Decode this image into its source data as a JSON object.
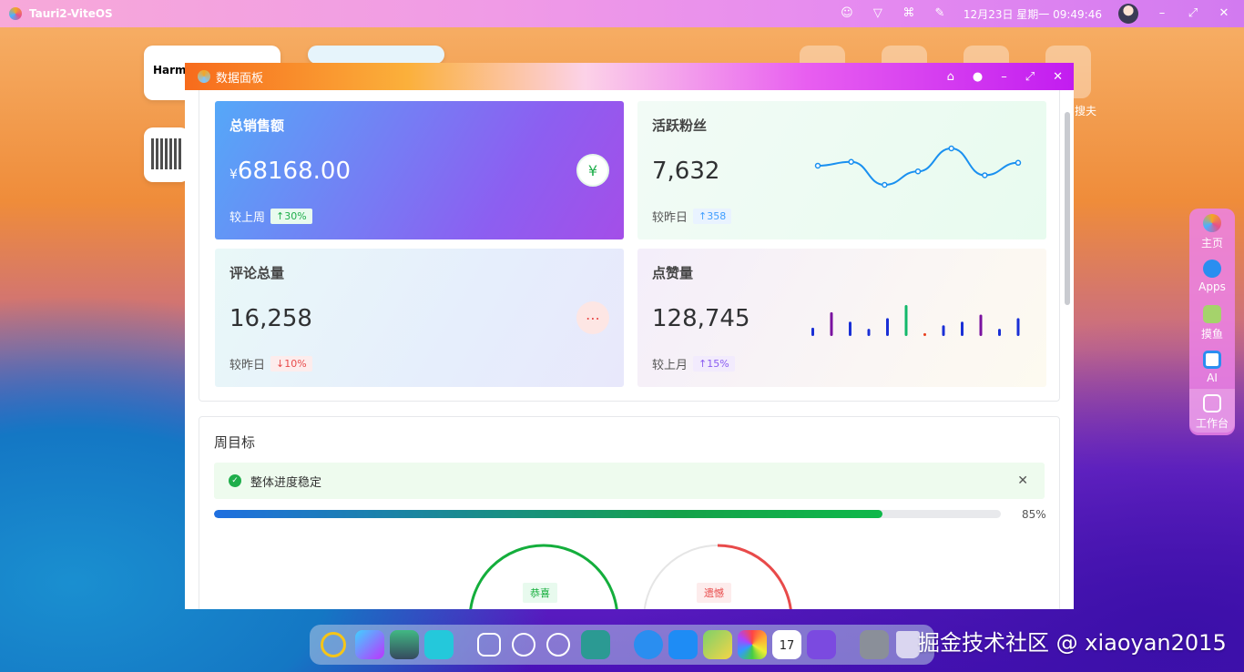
{
  "topbar": {
    "app_title": "Tauri2-ViteOS",
    "datetime": "12月23日 星期一 09:49:46"
  },
  "desktop": {
    "card_label": "Harmo",
    "group_label": "搜夫"
  },
  "window": {
    "title": "数据面板"
  },
  "cards": {
    "sales": {
      "title": "总销售额",
      "currency": "¥",
      "value": "68168.00",
      "compare_label": "较上周",
      "change": "↑30%"
    },
    "fans": {
      "title": "活跃粉丝",
      "value": "7,632",
      "compare_label": "较昨日",
      "change": "↑358"
    },
    "comments": {
      "title": "评论总量",
      "value": "16,258",
      "compare_label": "较昨日",
      "change": "↓10%"
    },
    "likes": {
      "title": "点赞量",
      "value": "128,745",
      "compare_label": "较上月",
      "change": "↑15%"
    }
  },
  "fans_sparkline": [
    4.2,
    4.6,
    2.2,
    3.6,
    6.0,
    3.2,
    4.5
  ],
  "likes_bars": [
    {
      "v": 0.35,
      "color": "#1a2fd6"
    },
    {
      "v": 1.0,
      "color": "#7a12a0"
    },
    {
      "v": 0.6,
      "color": "#1a2fd6"
    },
    {
      "v": 0.3,
      "color": "#1a2fd6"
    },
    {
      "v": 0.75,
      "color": "#1a2fd6"
    },
    {
      "v": 1.3,
      "color": "#12b86a"
    },
    {
      "v": 0.12,
      "color": "#e8411f"
    },
    {
      "v": 0.45,
      "color": "#1a2fd6"
    },
    {
      "v": 0.6,
      "color": "#1a2fd6"
    },
    {
      "v": 0.9,
      "color": "#7a12a0"
    },
    {
      "v": 0.3,
      "color": "#1a2fd6"
    },
    {
      "v": 0.75,
      "color": "#1a2fd6"
    }
  ],
  "goals": {
    "title": "周目标",
    "alert_text": "整体进度稳定",
    "progress": 0.85,
    "progress_text": "85%",
    "gauge_success_tag": "恭喜",
    "gauge_fail_tag": "遗憾"
  },
  "right_dock": [
    {
      "label": "主页",
      "icon": "home-icon"
    },
    {
      "label": "Apps",
      "icon": "compass-icon"
    },
    {
      "label": "摸鱼",
      "icon": "fish-icon"
    },
    {
      "label": "AI",
      "icon": "robot-icon"
    },
    {
      "label": "工作台",
      "icon": "workbench-icon"
    }
  ],
  "dock_calendar_day": "17",
  "watermark": "掘金技术社区 @ xiaoyan2015",
  "colors": {
    "success": "#1fae4b",
    "danger": "#e84a4a",
    "accent": "#409eff"
  }
}
